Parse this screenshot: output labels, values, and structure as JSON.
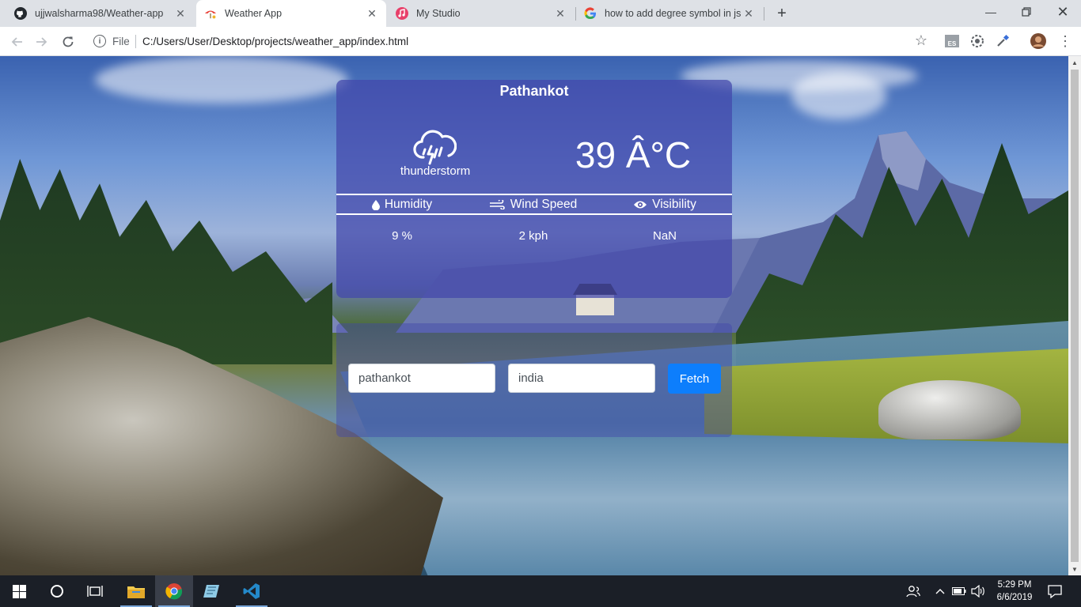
{
  "browser": {
    "tabs": [
      {
        "title": "ujjwalsharma98/Weather-app",
        "icon": "github-icon"
      },
      {
        "title": "Weather App",
        "icon": "weather-app-icon"
      },
      {
        "title": "My Studio",
        "icon": "studio-icon"
      },
      {
        "title": "how to add degree symbol in js -",
        "icon": "google-icon"
      }
    ],
    "active_tab_index": 1,
    "address": {
      "scheme_label": "File",
      "url": "C:/Users/User/Desktop/projects/weather_app/index.html"
    },
    "extension_badge": "ES"
  },
  "weather": {
    "city": "Pathankot",
    "condition": "thunderstorm",
    "condition_icon": "thunderstorm-icon",
    "temperature": "39 Â°C",
    "headers": {
      "humidity": "Humidity",
      "wind_speed": "Wind Speed",
      "visibility": "Visibility"
    },
    "values": {
      "humidity": "9 %",
      "wind_speed": "2 kph",
      "visibility": "NaN"
    }
  },
  "form": {
    "city_value": "pathankot",
    "country_value": "india",
    "fetch_label": "Fetch"
  },
  "taskbar": {
    "time": "5:29 PM",
    "date": "6/6/2019"
  },
  "colors": {
    "card": "#4246aa",
    "fetch_button": "#0d7efc",
    "taskbar": "#1b1f27"
  }
}
